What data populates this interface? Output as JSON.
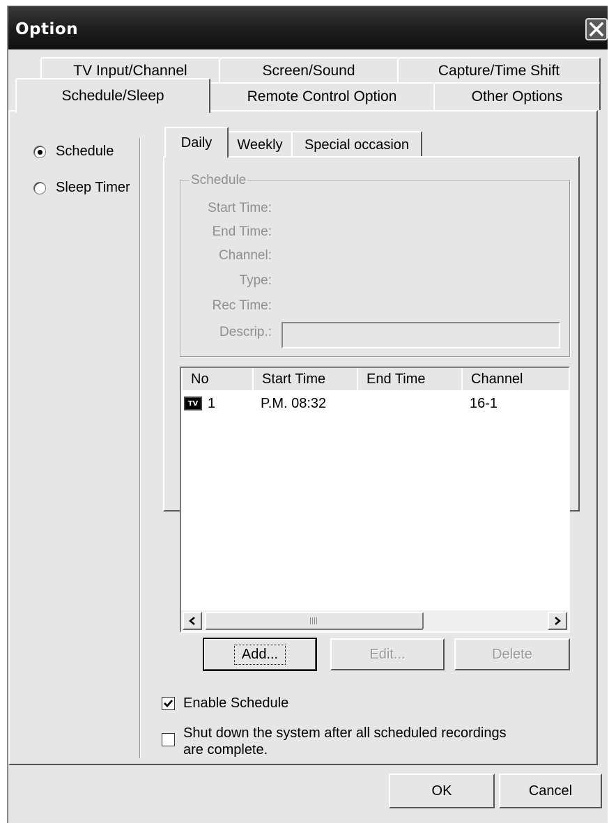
{
  "window": {
    "title": "Option"
  },
  "tabs": {
    "row1": [
      "TV Input/Channel",
      "Screen/Sound",
      "Capture/Time Shift"
    ],
    "row2": [
      "Schedule/Sleep",
      "Remote Control Option",
      "Other Options"
    ],
    "active": "Schedule/Sleep"
  },
  "mode": {
    "schedule": "Schedule",
    "sleep_timer": "Sleep Timer",
    "selected": "Schedule"
  },
  "subtabs": {
    "daily": "Daily",
    "weekly": "Weekly",
    "special": "Special occasion",
    "active": "Daily"
  },
  "schedule_group": {
    "legend": "Schedule",
    "start_time": "Start Time:",
    "end_time": "End Time:",
    "channel": "Channel:",
    "type": "Type:",
    "rec_time": "Rec Time:",
    "descrip": "Descrip.:",
    "descrip_value": ""
  },
  "list": {
    "columns": [
      "No",
      "Start Time",
      "End Time",
      "Channel"
    ],
    "rows": [
      {
        "icon": "tv-icon",
        "icon_text": "TV",
        "no": "1",
        "start": "P.M. 08:32",
        "end": "",
        "channel": "16-1"
      }
    ]
  },
  "buttons": {
    "add": "Add...",
    "edit": "Edit...",
    "delete": "Delete",
    "ok": "OK",
    "cancel": "Cancel"
  },
  "options": {
    "enable_schedule": "Enable Schedule",
    "enable_schedule_checked": true,
    "shutdown_line1": "Shut down the system after all scheduled recordings",
    "shutdown_line2": "are complete.",
    "shutdown_checked": false
  },
  "colors": {
    "face": "#e6e6e6",
    "titlebar": "#1e1e1e",
    "disabled_text": "#8f8f8f"
  }
}
